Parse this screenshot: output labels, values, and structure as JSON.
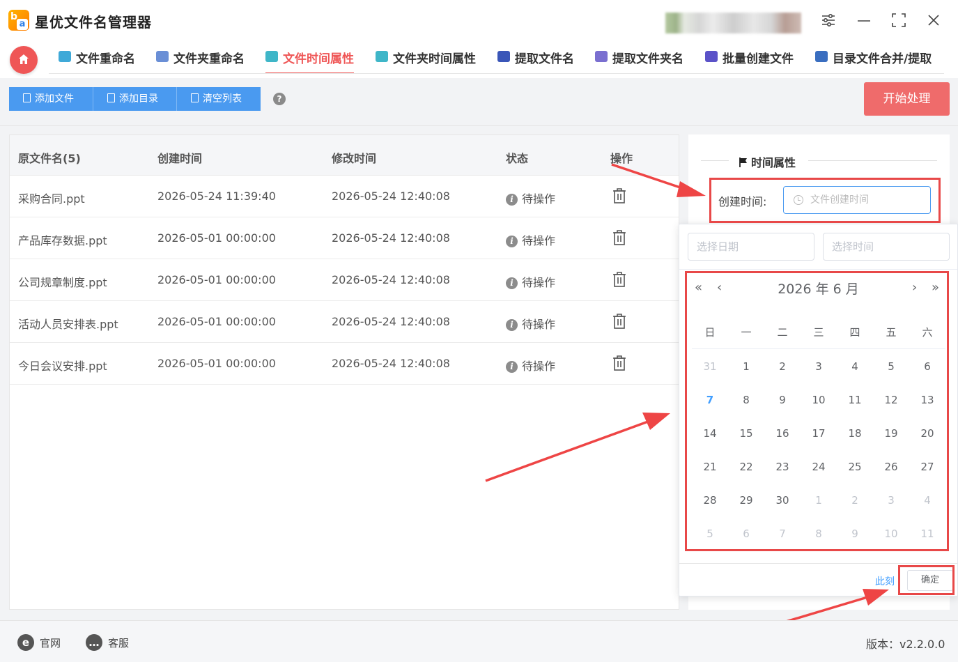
{
  "app": {
    "title": "星优文件名管理器"
  },
  "tabs": [
    {
      "label": "文件重命名",
      "active": false,
      "icon": "rename-icon",
      "color": "#3fa9d8"
    },
    {
      "label": "文件夹重命名",
      "active": false,
      "icon": "folder-rename-icon",
      "color": "#6a8fd6"
    },
    {
      "label": "文件时间属性",
      "active": true,
      "icon": "file-time-icon",
      "color": "#3fb6c8"
    },
    {
      "label": "文件夹时间属性",
      "active": false,
      "icon": "folder-time-icon",
      "color": "#3fb6c8"
    },
    {
      "label": "提取文件名",
      "active": false,
      "icon": "extract-filename-icon",
      "color": "#3a56b8"
    },
    {
      "label": "提取文件夹名",
      "active": false,
      "icon": "extract-foldername-icon",
      "color": "#7a6fd0"
    },
    {
      "label": "批量创建文件",
      "active": false,
      "icon": "batch-create-icon",
      "color": "#5b52c8"
    },
    {
      "label": "目录文件合并/提取",
      "active": false,
      "icon": "merge-extract-icon",
      "color": "#3a6ec0"
    }
  ],
  "toolbar": {
    "add_file": "添加文件",
    "add_dir": "添加目录",
    "clear_list": "清空列表",
    "help": "?",
    "start": "开始处理"
  },
  "table": {
    "headers": [
      "原文件名(5)",
      "创建时间",
      "修改时间",
      "状态",
      "操作"
    ],
    "rows": [
      {
        "name": "采购合同.ppt",
        "created": "2026-05-24 11:39:40",
        "modified": "2026-05-24 12:40:08",
        "status": "待操作"
      },
      {
        "name": "产品库存数据.ppt",
        "created": "2026-05-01 00:00:00",
        "modified": "2026-05-24 12:40:08",
        "status": "待操作"
      },
      {
        "name": "公司规章制度.ppt",
        "created": "2026-05-01 00:00:00",
        "modified": "2026-05-24 12:40:08",
        "status": "待操作"
      },
      {
        "name": "活动人员安排表.ppt",
        "created": "2026-05-01 00:00:00",
        "modified": "2026-05-24 12:40:08",
        "status": "待操作"
      },
      {
        "name": "今日会议安排.ppt",
        "created": "2026-05-01 00:00:00",
        "modified": "2026-05-24 12:40:08",
        "status": "待操作"
      }
    ]
  },
  "right_panel": {
    "title": "时间属性",
    "create_time_label": "创建时间:",
    "create_time_placeholder": "文件创建时间"
  },
  "picker": {
    "date_placeholder": "选择日期",
    "time_placeholder": "选择时间",
    "year_month": "2026 年  6 月",
    "weekdays": [
      "日",
      "一",
      "二",
      "三",
      "四",
      "五",
      "六"
    ],
    "weeks": [
      [
        "31",
        "1",
        "2",
        "3",
        "4",
        "5",
        "6"
      ],
      [
        "7",
        "8",
        "9",
        "10",
        "11",
        "12",
        "13"
      ],
      [
        "14",
        "15",
        "16",
        "17",
        "18",
        "19",
        "20"
      ],
      [
        "21",
        "22",
        "23",
        "24",
        "25",
        "26",
        "27"
      ],
      [
        "28",
        "29",
        "30",
        "1",
        "2",
        "3",
        "4"
      ],
      [
        "5",
        "6",
        "7",
        "8",
        "9",
        "10",
        "11"
      ]
    ],
    "today": "7",
    "now_label": "此刻",
    "confirm_label": "确定"
  },
  "footer": {
    "website": "官网",
    "support": "客服",
    "version": "版本：v2.2.0.0"
  },
  "colors": {
    "accent_red": "#ef5656",
    "primary_blue": "#4a9af0",
    "annotation_red": "#e84848",
    "today_blue": "#409eff"
  }
}
